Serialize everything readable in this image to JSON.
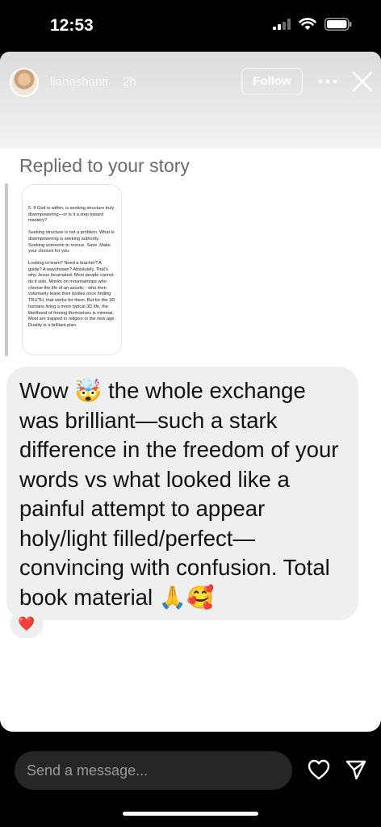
{
  "status_bar": {
    "time": "12:53",
    "icons": [
      "cellular-signal-icon",
      "wifi-icon",
      "battery-icon"
    ]
  },
  "story_header": {
    "username": "lianashanti",
    "time_ago": "2h",
    "follow_label": "Follow",
    "icons": [
      "more-icon",
      "close-icon"
    ]
  },
  "reply": {
    "label": "Replied to your story",
    "story_text": [
      "5. If God is within, is seeking structure truly disempowering—or is it a step toward mastery?",
      "Seeking structure is not a problem. What is disempowering is seeking authority. Seeking someone to rescue. Save. Make your choices for you.",
      "Looking to learn? Need a teacher? A guide? A wayshower? Absolutely. That's why Jesus incarnated. Most people cannot do it solo. Monks on mountaintops who choose the life of an ascetic - who then voluntarily leave their bodies once finding TRUTH, that works for them. But for the 3D humans living a more typical 3D life, the likelihood of freeing themselves  is minimal. Most are trapped in religion or the new age. Duality is a brilliant plan."
    ]
  },
  "message": {
    "text": "Wow 🤯 the whole exchange was brilliant—such a stark difference in the freedom of your words vs what looked like a painful attempt to appear holy/light filled/perfect—convincing with confusion. Total book material 🙏🥰",
    "reaction": "❤️"
  },
  "composer": {
    "placeholder": "Send a message...",
    "icons": [
      "heart-icon",
      "send-icon"
    ]
  },
  "colors": {
    "background": "#000000",
    "card": "#ffffff",
    "bubble": "#efefef",
    "input": "#262626"
  }
}
